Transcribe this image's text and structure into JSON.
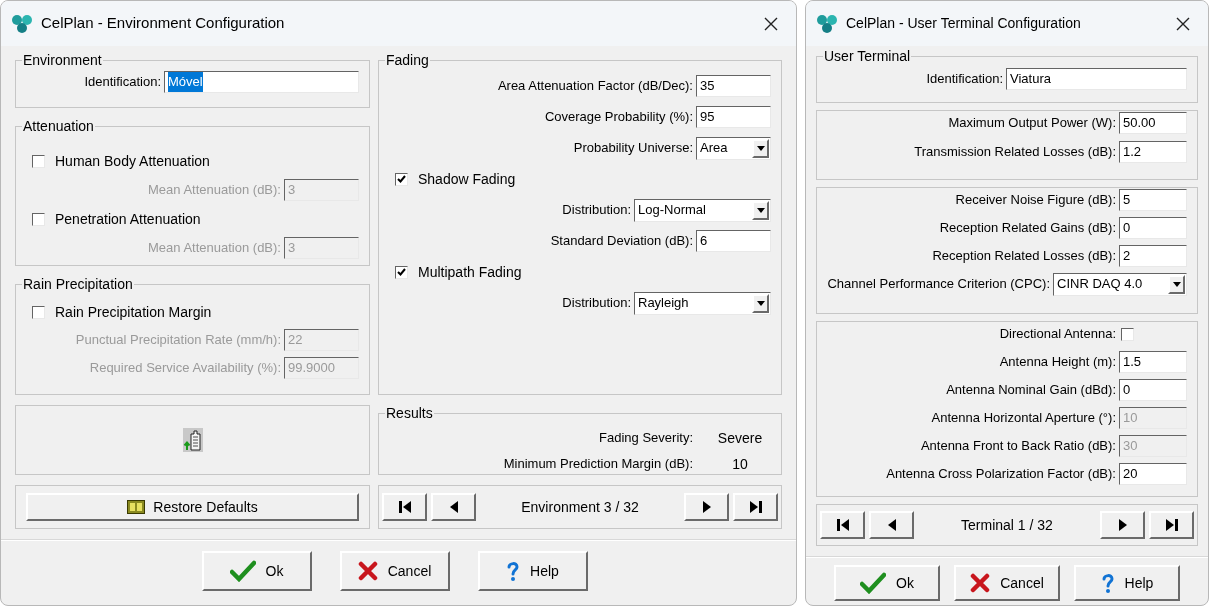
{
  "windows": [
    {
      "title": "CelPlan - Environment Configuration",
      "columns": [
        [
          {
            "kind": "group",
            "legend": "Environment",
            "rows": [
              {
                "kind": "field",
                "label": "Identification:",
                "value": "Móvel",
                "disabled": false,
                "label_disabled": false,
                "highlighted": true
              }
            ]
          },
          {
            "kind": "group",
            "legend": "Attenuation",
            "rows": [
              {
                "kind": "checkbox",
                "label": "Human Body Attenuation",
                "checked": false
              },
              {
                "kind": "field",
                "label": "Mean Attenuation (dB):",
                "value": "3",
                "disabled": true,
                "label_disabled": true,
                "highlighted": false
              },
              {
                "kind": "checkbox",
                "label": "Penetration Attenuation",
                "checked": false
              },
              {
                "kind": "field",
                "label": "Mean Attenuation (dB):",
                "value": "3",
                "disabled": true,
                "label_disabled": true,
                "highlighted": false
              }
            ]
          },
          {
            "kind": "group",
            "legend": "Rain Precipitation",
            "rows": [
              {
                "kind": "checkbox",
                "label": "Rain Precipitation Margin",
                "checked": false
              },
              {
                "kind": "field",
                "label": "Punctual Precipitation Rate (mm/h):",
                "value": "22",
                "disabled": true,
                "label_disabled": true,
                "highlighted": false
              },
              {
                "kind": "field",
                "label": "Required Service Availability (%):",
                "value": "99.9000",
                "disabled": true,
                "label_disabled": true,
                "highlighted": false
              }
            ]
          },
          {
            "kind": "icon_panel"
          },
          {
            "kind": "restore",
            "label": "Restore Defaults"
          }
        ],
        [
          {
            "kind": "group",
            "legend": "Fading",
            "rows": [
              {
                "kind": "field",
                "label": "Area Attenuation Factor (dB/Dec):",
                "value": "35",
                "disabled": false,
                "label_disabled": false,
                "highlighted": false
              },
              {
                "kind": "field",
                "label": "Coverage Probability (%):",
                "value": "95",
                "disabled": false,
                "label_disabled": false,
                "highlighted": false
              },
              {
                "kind": "select",
                "label": "Probability Universe:",
                "value": "Area"
              },
              {
                "kind": "checkbox",
                "label": "Shadow Fading",
                "checked": true
              },
              {
                "kind": "select",
                "label": "Distribution:",
                "value": "Log-Normal"
              },
              {
                "kind": "field",
                "label": "Standard Deviation (dB):",
                "value": "6",
                "disabled": false,
                "label_disabled": false,
                "highlighted": false
              },
              {
                "kind": "checkbox",
                "label": "Multipath Fading",
                "checked": true
              },
              {
                "kind": "select",
                "label": "Distribution:",
                "value": "Rayleigh"
              }
            ]
          },
          {
            "kind": "results",
            "legend": "Results",
            "rows": [
              {
                "label": "Fading Severity:",
                "value": "Severe"
              },
              {
                "label": "Minimum Prediction Margin (dB):",
                "value": "10"
              }
            ]
          },
          {
            "kind": "nav",
            "label": "Environment 3 / 32"
          }
        ]
      ],
      "buttons": [
        {
          "kind": "ok",
          "label": "Ok"
        },
        {
          "kind": "cancel",
          "label": "Cancel"
        },
        {
          "kind": "help",
          "label": "Help"
        }
      ]
    },
    {
      "title": "CelPlan - User Terminal Configuration",
      "columns": [
        [
          {
            "kind": "group",
            "legend": "User Terminal",
            "rows": [
              {
                "kind": "field",
                "label": "Identification:",
                "value": "Viatura",
                "disabled": false,
                "label_disabled": false,
                "highlighted": false
              }
            ]
          },
          {
            "kind": "group",
            "rows": [
              {
                "kind": "field",
                "label": "Maximum Output Power (W):",
                "value": "50.00",
                "disabled": false,
                "label_disabled": false,
                "highlighted": false
              },
              {
                "kind": "field",
                "label": "Transmission Related Losses (dB):",
                "value": "1.2",
                "disabled": false,
                "label_disabled": false,
                "highlighted": false
              }
            ]
          },
          {
            "kind": "group",
            "rows": [
              {
                "kind": "field",
                "label": "Receiver Noise Figure (dB):",
                "value": "5",
                "disabled": false,
                "label_disabled": false,
                "highlighted": false
              },
              {
                "kind": "field",
                "label": "Reception Related Gains (dB):",
                "value": "0",
                "disabled": false,
                "label_disabled": false,
                "highlighted": false
              },
              {
                "kind": "field",
                "label": "Reception Related Losses (dB):",
                "value": "2",
                "disabled": false,
                "label_disabled": false,
                "highlighted": false
              },
              {
                "kind": "select",
                "label": "Channel Performance Criterion (CPC):",
                "value": "CINR DAQ 4.0"
              }
            ]
          },
          {
            "kind": "group",
            "rows": [
              {
                "kind": "checkfield",
                "label": "Directional Antenna:",
                "checked": false
              },
              {
                "kind": "field",
                "label": "Antenna Height (m):",
                "value": "1.5",
                "disabled": false,
                "label_disabled": false,
                "highlighted": false
              },
              {
                "kind": "field",
                "label": "Antenna Nominal Gain (dBd):",
                "value": "0",
                "disabled": false,
                "label_disabled": false,
                "highlighted": false
              },
              {
                "kind": "field",
                "label": "Antenna Horizontal Aperture (°):",
                "value": "10",
                "disabled": true,
                "label_disabled": false,
                "highlighted": false
              },
              {
                "kind": "field",
                "label": "Antenna Front to Back Ratio (dB):",
                "value": "30",
                "disabled": true,
                "label_disabled": false,
                "highlighted": false
              },
              {
                "kind": "field",
                "label": "Antenna Cross Polarization Factor (dB):",
                "value": "20",
                "disabled": false,
                "label_disabled": false,
                "highlighted": false
              }
            ]
          },
          {
            "kind": "nav",
            "label": "Terminal 1 / 32"
          }
        ]
      ],
      "buttons": [
        {
          "kind": "ok",
          "label": "Ok"
        },
        {
          "kind": "cancel",
          "label": "Cancel"
        },
        {
          "kind": "help",
          "label": "Help"
        }
      ]
    }
  ]
}
